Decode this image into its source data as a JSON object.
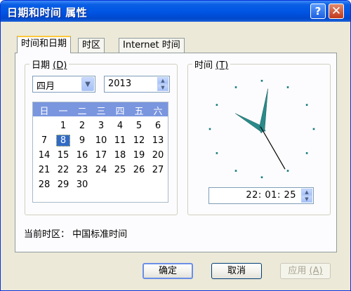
{
  "window": {
    "title": "日期和时间 属性"
  },
  "titlebar": {
    "help": "?",
    "close": "✕"
  },
  "tabs": [
    {
      "label": "时间和日期"
    },
    {
      "label": "时区"
    },
    {
      "label": "Internet 时间"
    }
  ],
  "date_group": {
    "legend": "日期",
    "hotkey": "(D)",
    "month_value": "四月",
    "year_value": "2013"
  },
  "calendar": {
    "weekdays": [
      "日",
      "一",
      "二",
      "三",
      "四",
      "五",
      "六"
    ],
    "weeks": [
      [
        "",
        "1",
        "2",
        "3",
        "4",
        "5",
        "6"
      ],
      [
        "7",
        "8",
        "9",
        "10",
        "11",
        "12",
        "13"
      ],
      [
        "14",
        "15",
        "16",
        "17",
        "18",
        "19",
        "20"
      ],
      [
        "21",
        "22",
        "23",
        "24",
        "25",
        "26",
        "27"
      ],
      [
        "28",
        "29",
        "30",
        "",
        "",
        "",
        ""
      ]
    ],
    "selected_day": "8"
  },
  "time_group": {
    "legend": "时间",
    "hotkey": "(T)",
    "time_value": "22: 01: 25"
  },
  "clock": {
    "hour": 22,
    "minute": 1,
    "second": 25,
    "hand_color": "#2a8a8a"
  },
  "timezone": {
    "label": "当前时区：  中国标准时间"
  },
  "buttons": {
    "ok": "确定",
    "cancel": "取消",
    "apply": "应用",
    "apply_hotkey": "(A)"
  }
}
